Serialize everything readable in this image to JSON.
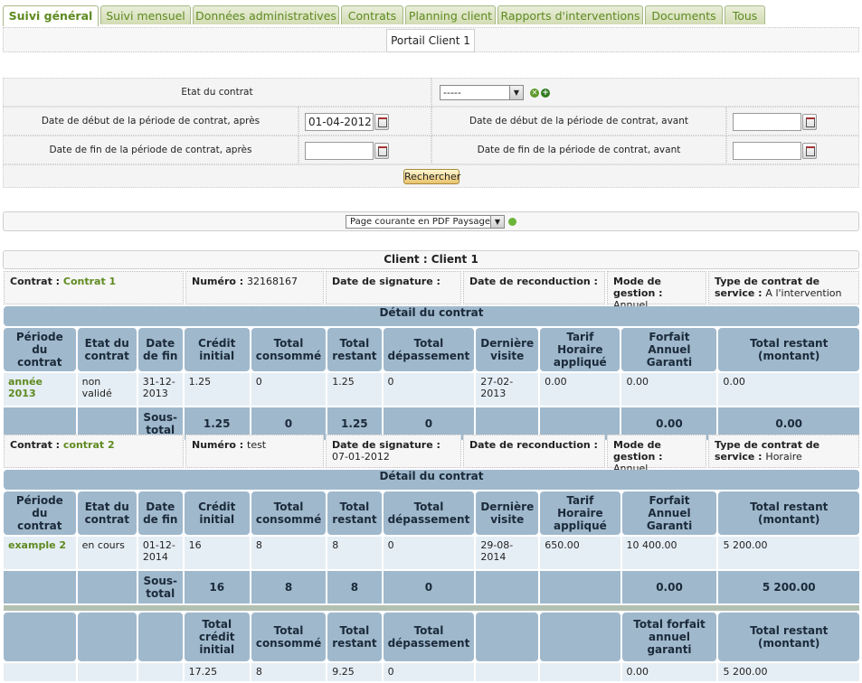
{
  "tabs": [
    "Suivi général",
    "Suivi mensuel",
    "Données administratives",
    "Contrats",
    "Planning client",
    "Rapports d'interventions",
    "Documents",
    "Tous"
  ],
  "portal_title": "Portail Client 1",
  "filters": {
    "etat_label": "Etat du contrat",
    "etat_value": "-----",
    "debut_apres_label": "Date de début de la période de contrat, après",
    "debut_apres_value": "01-04-2012",
    "debut_avant_label": "Date de début de la période de contrat, avant",
    "debut_avant_value": "",
    "fin_apres_label": "Date de fin de la période de contrat, après",
    "fin_apres_value": "",
    "fin_avant_label": "Date de fin de la période de contrat, avant",
    "fin_avant_value": "",
    "search_label": "Rechercher"
  },
  "export": {
    "selected": "Page courante en PDF Paysage"
  },
  "client_header": "Client : Client 1",
  "info_labels": {
    "contrat": "Contrat : ",
    "numero": "Numéro : ",
    "signature": "Date de signature : ",
    "reconduction": "Date de reconduction : ",
    "mode": "Mode de gestion : ",
    "type": "Type de contrat de service : "
  },
  "detail_title": "Détail du contrat",
  "columns": [
    "Période du contrat",
    "Etat du contrat",
    "Date de fin",
    "Crédit initial",
    "Total consommé",
    "Total restant",
    "Total dépassement",
    "Dernière visite",
    "Tarif Horaire appliqué",
    "Forfait Annuel Garanti",
    "Total restant (montant)"
  ],
  "subtotal_label": "Sous-total",
  "contracts": [
    {
      "name": "Contrat 1",
      "numero": "32168167",
      "signature": "",
      "reconduction": "",
      "mode": "Annuel",
      "type": "A l'intervention",
      "row": [
        "année 2013",
        "non validé",
        "31-12-2013",
        "1.25",
        "0",
        "1.25",
        "0",
        "27-02-2013",
        "0.00",
        "0.00",
        "0.00"
      ],
      "subtotal": [
        "1.25",
        "0",
        "1.25",
        "0",
        "0.00",
        "0.00"
      ]
    },
    {
      "name": "contrat 2",
      "numero": "test",
      "signature": "07-01-2012",
      "reconduction": "",
      "mode": "Annuel",
      "type": "Horaire",
      "row": [
        "example 2",
        "en cours",
        "01-12-2014",
        "16",
        "8",
        "8",
        "0",
        "29-08-2014",
        "650.00",
        "10 400.00",
        "5 200.00"
      ],
      "subtotal": [
        "16",
        "8",
        "8",
        "0",
        "0.00",
        "5 200.00"
      ]
    }
  ],
  "totals_columns": [
    "Total crédit initial",
    "Total consommé",
    "Total restant",
    "Total dépassement",
    "Total forfait annuel garanti",
    "Total restant (montant)"
  ],
  "totals": [
    "17.25",
    "8",
    "9.25",
    "0",
    "0.00",
    "5 200.00"
  ]
}
